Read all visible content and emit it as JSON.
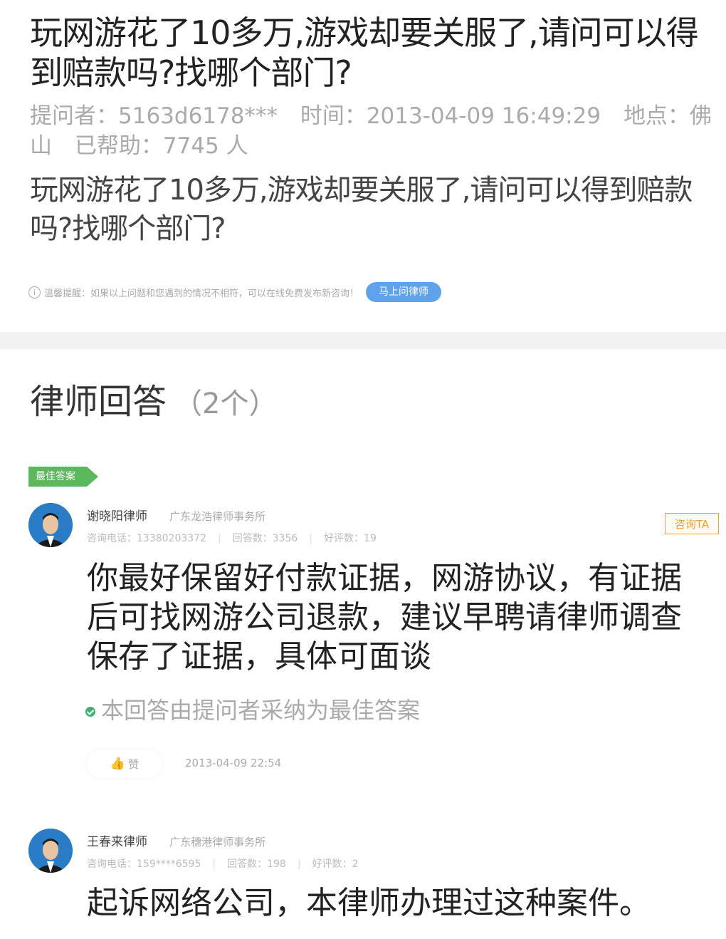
{
  "question": {
    "title": "玩网游花了10多万,游戏却要关服了,请问可以得到赔款吗?找哪个部门?",
    "meta": {
      "asker": "提问者：5163d6178***",
      "time": "时间：2013-04-09 16:49:29",
      "location": "地点：佛山",
      "helped": "已帮助：7745 人"
    },
    "body": "玩网游花了10多万,游戏却要关服了,请问可以得到赔款吗?找哪个部门?"
  },
  "tip": {
    "icon": "info-icon",
    "text": "温馨提醒：如果以上问题和您遇到的情况不相符，可以在线免费发布新咨询！",
    "button_label": "马上问律师"
  },
  "answers": {
    "title": "律师回答",
    "count": "（2个）",
    "best_label": "最佳答案",
    "items": [
      {
        "name": "谢晓阳律师",
        "firm": "广东龙浩律师事务所",
        "phone": "咨询电话：13380203372",
        "answer_count": "回答数：3356",
        "rating": "好评数：19",
        "consult_label": "咨询TA",
        "text": "你最好保留好付款证据，网游协议，有证据后可找网游公司退款，建议早聘请律师调查保存了证据，具体可面谈",
        "adopted": "本回答由提问者采纳为最佳答案",
        "like_label": "赞",
        "date": "2013-04-09 22:54"
      },
      {
        "name": "王春来律师",
        "firm": "广东穗港律师事务所",
        "phone": "咨询电话：159****6595",
        "answer_count": "回答数：198",
        "rating": "好评数：2",
        "text": "起诉网络公司，本律师办理过这种案件。"
      }
    ]
  },
  "colors": {
    "accent_blue": "#5ea3ea",
    "best_green": "#5cb85c",
    "consult_orange": "#f0a030"
  }
}
